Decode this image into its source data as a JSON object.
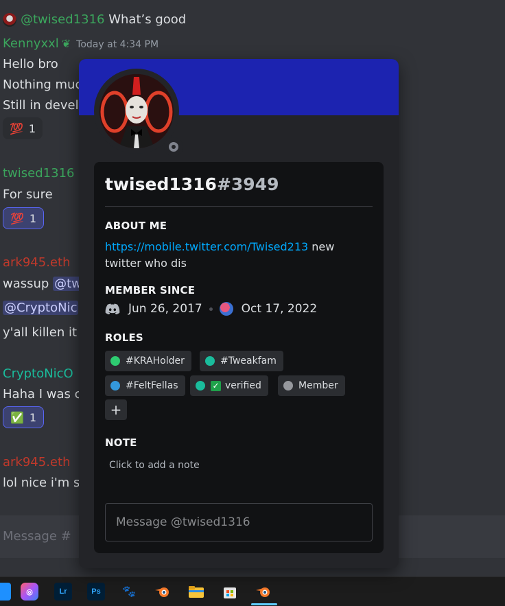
{
  "chat": {
    "messages": [
      {
        "reply_user": "@twised1316",
        "reply_text": "What’s good"
      },
      {
        "author": "Kennyxxl",
        "timestamp": "Today at 4:34 PM",
        "lines": [
          "Hello bro",
          "Nothing muc",
          "Still in develo"
        ],
        "reaction": {
          "emoji": "💯",
          "count": "1"
        }
      },
      {
        "author": "twised1316",
        "lines": [
          "For sure"
        ],
        "reaction": {
          "emoji": "💯",
          "count": "1"
        }
      },
      {
        "author": "ark945.eth",
        "lines": [
          "wassup",
          "y'all killen it"
        ],
        "mentions": [
          "@tw",
          "@CryptoNic"
        ]
      },
      {
        "author": "CryptoNicO",
        "lines": [
          "Haha I was c"
        ],
        "reaction": {
          "emoji": "✅",
          "count": "1"
        }
      },
      {
        "author": "ark945.eth",
        "lines": [
          "lol nice i'm s"
        ]
      }
    ],
    "composer_placeholder": "Message #"
  },
  "profile": {
    "username": "twised1316",
    "discriminator": "#3949",
    "about_me_title": "ABOUT ME",
    "about_link": "https://mobile.twitter.com/Twised213",
    "about_text": " new twitter who dis",
    "member_since_title": "MEMBER SINCE",
    "discord_since": "Jun 26, 2017",
    "server_since": "Oct 17, 2022",
    "roles_title": "ROLES",
    "roles": [
      {
        "name": "#KRAHolder",
        "color": "#2ecc71"
      },
      {
        "name": "#Tweakfam",
        "color": "#1abc9c"
      },
      {
        "name": "#FeltFellas",
        "color": "#3498db"
      },
      {
        "name": "verified",
        "color": "#1abc9c"
      },
      {
        "name": "Member",
        "color": "#96989d"
      }
    ],
    "add_role_symbol": "+",
    "note_title": "NOTE",
    "note_placeholder": "Click to add a note",
    "message_placeholder": "Message @twised1316",
    "banner_color": "#1c23b0",
    "status": "offline"
  },
  "taskbar": {
    "apps": [
      "Lr",
      "Ps"
    ]
  }
}
